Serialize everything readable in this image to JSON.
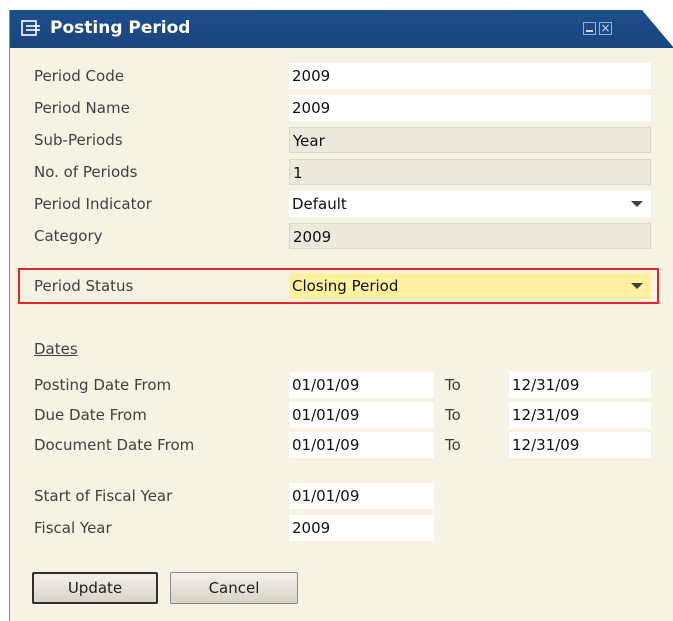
{
  "window": {
    "title": "Posting Period"
  },
  "fields": {
    "period_code": {
      "label": "Period Code",
      "value": "2009"
    },
    "period_name": {
      "label": "Period Name",
      "value": "2009"
    },
    "sub_periods": {
      "label": "Sub-Periods",
      "value": "Year"
    },
    "no_of_periods": {
      "label": "No. of Periods",
      "value": "1"
    },
    "period_indicator": {
      "label": "Period Indicator",
      "value": "Default"
    },
    "category": {
      "label": "Category",
      "value": "2009"
    },
    "period_status": {
      "label": "Period Status",
      "value": "Closing Period"
    }
  },
  "dates": {
    "section_label": "Dates",
    "to_label": "To",
    "posting": {
      "label": "Posting Date From",
      "from": "01/01/09",
      "to": "12/31/09"
    },
    "due": {
      "label": "Due Date From",
      "from": "01/01/09",
      "to": "12/31/09"
    },
    "document": {
      "label": "Document Date From",
      "from": "01/01/09",
      "to": "12/31/09"
    }
  },
  "fiscal": {
    "start": {
      "label": "Start of Fiscal Year",
      "value": "01/01/09"
    },
    "year": {
      "label": "Fiscal Year",
      "value": "2009"
    }
  },
  "buttons": {
    "update": "Update",
    "cancel": "Cancel"
  },
  "colors": {
    "titlebar": "#1f4e8c",
    "highlight_border": "#e0282a",
    "status_field": "#fff1a0",
    "form_background": "#f7f3e4"
  }
}
